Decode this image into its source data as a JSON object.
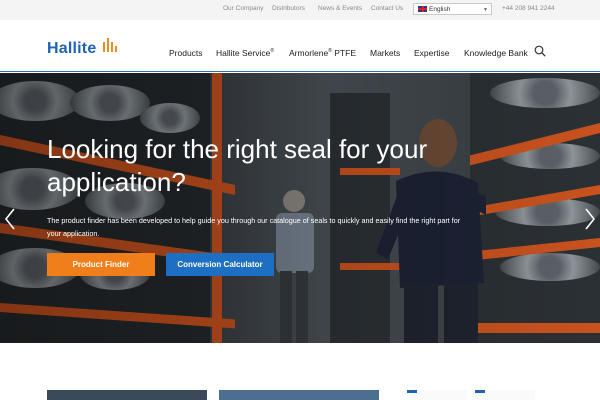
{
  "utility": {
    "links": [
      "Our Company",
      "Distributors",
      "News & Events",
      "Contact Us"
    ],
    "language": "English",
    "phone": "+44 208 941 2244"
  },
  "header": {
    "logo": "Hallite",
    "nav": [
      {
        "label": "Products",
        "sup": ""
      },
      {
        "label": "Hallite Service",
        "sup": "®"
      },
      {
        "label": "Armorlene",
        "sup": "®",
        "suffix": " PTFE"
      },
      {
        "label": "Markets",
        "sup": ""
      },
      {
        "label": "Expertise",
        "sup": ""
      },
      {
        "label": "Knowledge Bank",
        "sup": ""
      }
    ],
    "search_icon": "search-icon"
  },
  "hero": {
    "title": "Looking for the right seal for your application?",
    "body": "The product finder has been developed to help guide you through our catalogue of seals to quickly and easily find the right part for your application.",
    "primary_button": "Product Finder",
    "secondary_button": "Conversion Calculator",
    "prev_icon": "chevron-left-icon",
    "next_icon": "chevron-right-icon"
  },
  "colors": {
    "brand_blue": "#1e63b5",
    "accent_orange": "#f07f1b",
    "button_blue": "#1d6fc4"
  }
}
